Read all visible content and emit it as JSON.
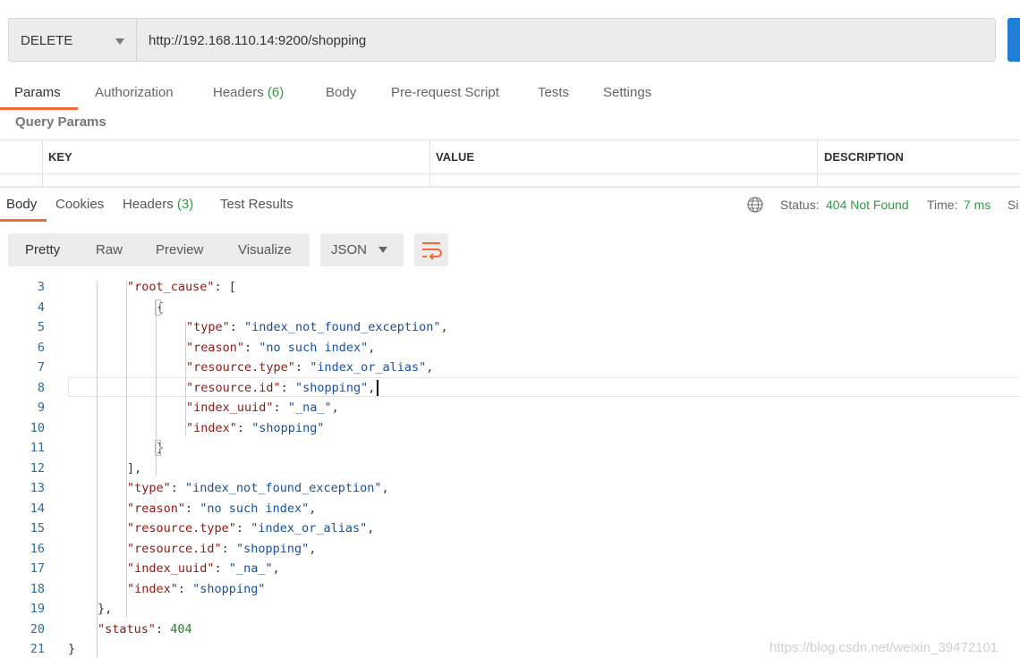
{
  "request": {
    "method": "DELETE",
    "url": "http://192.168.110.14:9200/shopping"
  },
  "request_tabs": [
    {
      "label": "Params",
      "count": ""
    },
    {
      "label": "Authorization",
      "count": ""
    },
    {
      "label": "Headers",
      "count": "(6)"
    },
    {
      "label": "Body",
      "count": ""
    },
    {
      "label": "Pre-request Script",
      "count": ""
    },
    {
      "label": "Tests",
      "count": ""
    },
    {
      "label": "Settings",
      "count": ""
    }
  ],
  "query_params": {
    "title": "Query Params",
    "columns": [
      "KEY",
      "VALUE",
      "DESCRIPTION"
    ]
  },
  "response_tabs": [
    {
      "label": "Body",
      "count": ""
    },
    {
      "label": "Cookies",
      "count": ""
    },
    {
      "label": "Headers",
      "count": "(3)"
    },
    {
      "label": "Test Results",
      "count": ""
    }
  ],
  "response_status": {
    "status_label": "Status:",
    "status_value": "404 Not Found",
    "time_label": "Time:",
    "time_value": "7 ms",
    "size_label": "Si"
  },
  "view_modes": [
    "Pretty",
    "Raw",
    "Preview",
    "Visualize"
  ],
  "format": "JSON",
  "colors": {
    "accent": "#f26b3a",
    "success": "#2e9d43",
    "send_button": "#1e7fd6"
  },
  "code_lines": [
    {
      "n": "3",
      "indent": 2,
      "parts": [
        [
          "k",
          "\"root_cause\""
        ],
        [
          "p",
          ": ["
        ]
      ]
    },
    {
      "n": "4",
      "indent": 3,
      "parts": [
        [
          "p",
          "{"
        ]
      ]
    },
    {
      "n": "5",
      "indent": 4,
      "parts": [
        [
          "k",
          "\"type\""
        ],
        [
          "p",
          ": "
        ],
        [
          "s",
          "\"index_not_found_exception\""
        ],
        [
          "p",
          ","
        ]
      ]
    },
    {
      "n": "6",
      "indent": 4,
      "parts": [
        [
          "k",
          "\"reason\""
        ],
        [
          "p",
          ": "
        ],
        [
          "s",
          "\"no such index\""
        ],
        [
          "p",
          ","
        ]
      ]
    },
    {
      "n": "7",
      "indent": 4,
      "parts": [
        [
          "k",
          "\"resource.type\""
        ],
        [
          "p",
          ": "
        ],
        [
          "s",
          "\"index_or_alias\""
        ],
        [
          "p",
          ","
        ]
      ]
    },
    {
      "n": "8",
      "indent": 4,
      "parts": [
        [
          "k",
          "\"resource.id\""
        ],
        [
          "p",
          ": "
        ],
        [
          "s",
          "\"shopping\""
        ],
        [
          "p",
          ","
        ]
      ]
    },
    {
      "n": "9",
      "indent": 4,
      "parts": [
        [
          "k",
          "\"index_uuid\""
        ],
        [
          "p",
          ": "
        ],
        [
          "s",
          "\"_na_\""
        ],
        [
          "p",
          ","
        ]
      ]
    },
    {
      "n": "10",
      "indent": 4,
      "parts": [
        [
          "k",
          "\"index\""
        ],
        [
          "p",
          ": "
        ],
        [
          "s",
          "\"shopping\""
        ]
      ]
    },
    {
      "n": "11",
      "indent": 3,
      "parts": [
        [
          "p",
          "}"
        ]
      ]
    },
    {
      "n": "12",
      "indent": 2,
      "parts": [
        [
          "p",
          "],"
        ]
      ]
    },
    {
      "n": "13",
      "indent": 2,
      "parts": [
        [
          "k",
          "\"type\""
        ],
        [
          "p",
          ": "
        ],
        [
          "s",
          "\"index_not_found_exception\""
        ],
        [
          "p",
          ","
        ]
      ]
    },
    {
      "n": "14",
      "indent": 2,
      "parts": [
        [
          "k",
          "\"reason\""
        ],
        [
          "p",
          ": "
        ],
        [
          "s",
          "\"no such index\""
        ],
        [
          "p",
          ","
        ]
      ]
    },
    {
      "n": "15",
      "indent": 2,
      "parts": [
        [
          "k",
          "\"resource.type\""
        ],
        [
          "p",
          ": "
        ],
        [
          "s",
          "\"index_or_alias\""
        ],
        [
          "p",
          ","
        ]
      ]
    },
    {
      "n": "16",
      "indent": 2,
      "parts": [
        [
          "k",
          "\"resource.id\""
        ],
        [
          "p",
          ": "
        ],
        [
          "s",
          "\"shopping\""
        ],
        [
          "p",
          ","
        ]
      ]
    },
    {
      "n": "17",
      "indent": 2,
      "parts": [
        [
          "k",
          "\"index_uuid\""
        ],
        [
          "p",
          ": "
        ],
        [
          "s",
          "\"_na_\""
        ],
        [
          "p",
          ","
        ]
      ]
    },
    {
      "n": "18",
      "indent": 2,
      "parts": [
        [
          "k",
          "\"index\""
        ],
        [
          "p",
          ": "
        ],
        [
          "s",
          "\"shopping\""
        ]
      ]
    },
    {
      "n": "19",
      "indent": 1,
      "parts": [
        [
          "p",
          "},"
        ]
      ]
    },
    {
      "n": "20",
      "indent": 1,
      "parts": [
        [
          "k",
          "\"status\""
        ],
        [
          "p",
          ": "
        ],
        [
          "n",
          "404"
        ]
      ]
    },
    {
      "n": "21",
      "indent": 0,
      "parts": [
        [
          "p",
          "}"
        ]
      ]
    }
  ],
  "watermark": "https://blog.csdn.net/weixin_39472101"
}
